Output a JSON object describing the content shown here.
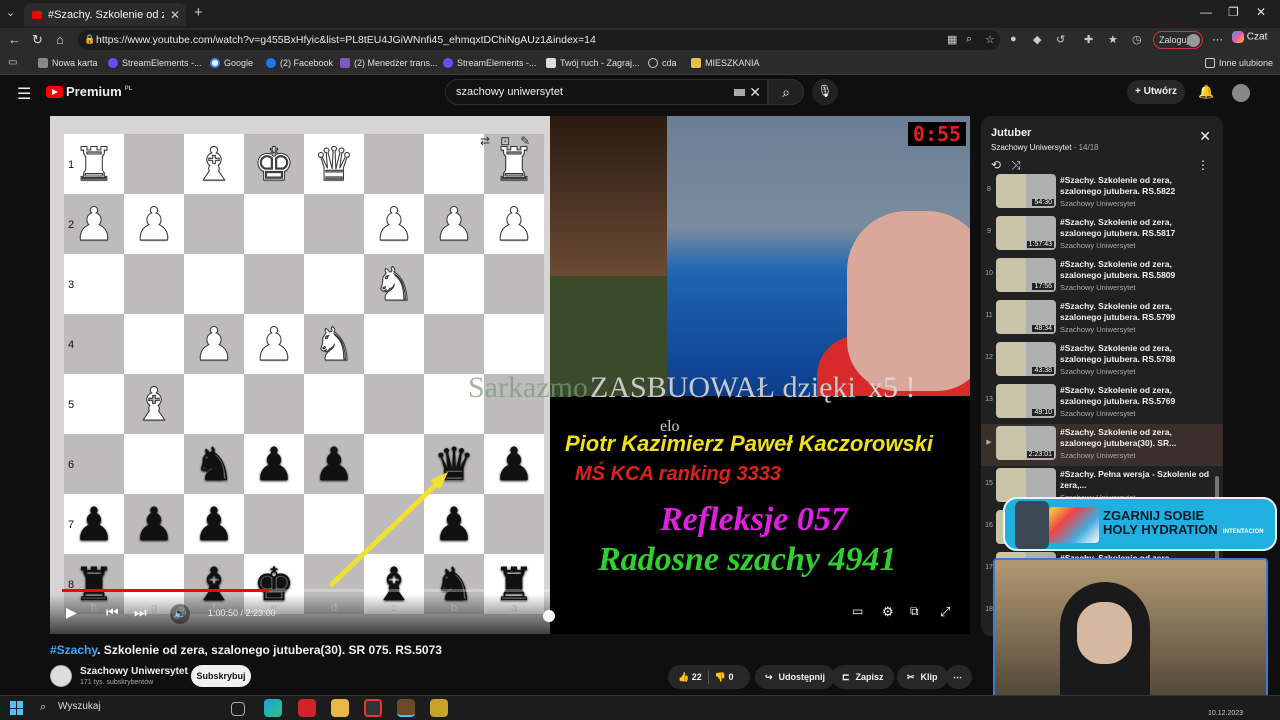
{
  "browser": {
    "tab_title": "#Szachy. Szkolenie od zera, szalon",
    "url": "https://www.youtube.com/watch?v=g455BxHfyic&list=PL8tEU4JGiWNnfi45_ehmqxtDChiNgAUz1&index=14",
    "login_label": "Zaloguj",
    "copilot_label": "Czat",
    "bookmarks": [
      "Nowa karta",
      "StreamElements -...",
      "Google",
      "(2) Facebook",
      "(2) Menedżer trans...",
      "StreamElements -...",
      "Twój ruch - Zagraj...",
      "cda",
      "MIESZKANIA"
    ],
    "other_bookmarks": "Inne ulubione"
  },
  "youtube": {
    "logo": "Premium",
    "logo_region": "PL",
    "search_value": "szachowy uniwersytet",
    "create_label": "Utwórz"
  },
  "video": {
    "timer": "0:55",
    "time_display": "1:00:50 / 2:23:00",
    "progress": 0.425,
    "overlay": {
      "sarkazm": "Sarkazmo",
      "zasbuowal": "ZASBUOWAŁ dzięki",
      "x5": "x5 !",
      "elo": "elo",
      "name": "Piotr Kazimierz Paweł Kaczorowski",
      "rank": "MŚ KCA ranking 3333",
      "reflex": "Refleksje 057",
      "radosne": "Radosne szachy 4941"
    },
    "ranks": [
      "1",
      "2",
      "3",
      "4",
      "5",
      "6",
      "7",
      "8"
    ],
    "files": [
      "h",
      "g",
      "f",
      "e",
      "d",
      "c",
      "b",
      "a"
    ],
    "board": [
      [
        "wR",
        "",
        "wB",
        "wK",
        "wQ",
        "",
        "",
        "wR"
      ],
      [
        "wP",
        "wP",
        "",
        "",
        "",
        "wP",
        "wP",
        "wP"
      ],
      [
        "",
        "",
        "",
        "",
        "",
        "wN",
        "",
        ""
      ],
      [
        "",
        "",
        "wP",
        "wP",
        "wN",
        "",
        "",
        ""
      ],
      [
        "",
        "wB",
        "",
        "",
        "",
        "",
        "",
        ""
      ],
      [
        "",
        "",
        "bN",
        "bP",
        "bP",
        "",
        "bQ",
        "bP"
      ],
      [
        "bP",
        "bP",
        "bP",
        "",
        "",
        "",
        "bP",
        ""
      ],
      [
        "bR",
        "",
        "bB",
        "bK",
        "",
        "bB",
        "bN",
        "bR"
      ]
    ],
    "title_tag": "#Szachy",
    "title_rest": ". Szkolenie od zera, szalonego jutubera(30). SR 075. RS.5073",
    "channel": "Szachowy Uniwersytet",
    "subscribers": "171 tys. subskrybentów",
    "subscribe_label": "Subskrybuj",
    "likes": "22",
    "dislikes": "0",
    "share_label": "Udostępnij",
    "save_label": "Zapisz",
    "clip_label": "Klip"
  },
  "playlist": {
    "title": "Jutuber",
    "channel": "Szachowy Uniwersytet",
    "position": "14/18",
    "items": [
      {
        "n": "8",
        "title": "#Szachy. Szkolenie od zera, szalonego jutubera. RS.5822",
        "channel": "Szachowy Uniwersytet",
        "duration": "54:30"
      },
      {
        "n": "9",
        "title": "#Szachy. Szkolenie od zera, szalonego jutubera. RS.5817",
        "channel": "Szachowy Uniwersytet",
        "duration": "1:57:43"
      },
      {
        "n": "10",
        "title": "#Szachy. Szkolenie od zera, szalonego jutubera. RS.5809",
        "channel": "Szachowy Uniwersytet",
        "duration": "17:56"
      },
      {
        "n": "11",
        "title": "#Szachy. Szkolenie od zera, szalonego jutubera. RS.5799",
        "channel": "Szachowy Uniwersytet",
        "duration": "48:34"
      },
      {
        "n": "12",
        "title": "#Szachy. Szkolenie od zera, szalonego jutubera. RS.5788",
        "channel": "Szachowy Uniwersytet",
        "duration": "43:38"
      },
      {
        "n": "13",
        "title": "#Szachy. Szkolenie od zera, szalonego jutubera. RS.5769",
        "channel": "Szachowy Uniwersytet",
        "duration": "49:10"
      },
      {
        "n": "▶",
        "title": "#Szachy. Szkolenie od zera, szalonego jutubera(30). SR...",
        "channel": "Szachowy Uniwersytet",
        "duration": "2:23:01"
      },
      {
        "n": "15",
        "title": "#Szachy. Pełna wersja - Szkolenie od zera,...",
        "channel": "Szachowy Uniwersytet",
        "duration": ""
      },
      {
        "n": "16",
        "title": "",
        "channel": "",
        "duration": ""
      },
      {
        "n": "17",
        "title": "#Szachy. Szkolenie od zera",
        "channel": "",
        "duration": ""
      },
      {
        "n": "18",
        "title": "",
        "channel": "",
        "duration": ""
      }
    ]
  },
  "ad": {
    "headline1": "ZGARNIJ SOBIE",
    "headline2": "HOLY HYDRATION",
    "brand": "INTENTACION"
  },
  "taskbar": {
    "search_placeholder": "Wyszukaj",
    "clock": "10.12.2023"
  },
  "colors": {
    "accent": "#ff0000",
    "link": "#3ea6ff",
    "arrow": "#f0e030"
  }
}
